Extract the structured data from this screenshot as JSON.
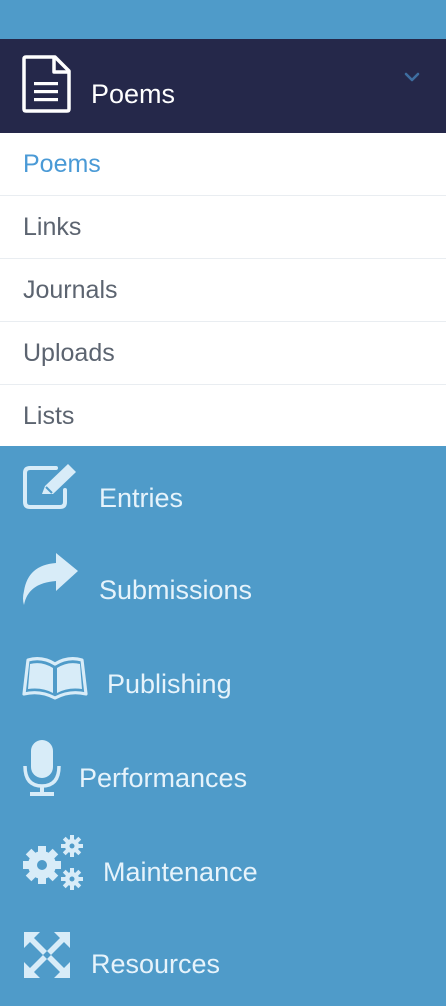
{
  "header": {
    "title": "Poems",
    "icon": "document-icon",
    "chevron": "chevron-down-icon"
  },
  "submenu": [
    {
      "label": "Poems",
      "active": true
    },
    {
      "label": "Links",
      "active": false
    },
    {
      "label": "Journals",
      "active": false
    },
    {
      "label": "Uploads",
      "active": false
    },
    {
      "label": "Lists",
      "active": false
    }
  ],
  "nav": [
    {
      "label": "Entries",
      "icon": "edit-icon"
    },
    {
      "label": "Submissions",
      "icon": "share-arrow-icon"
    },
    {
      "label": "Publishing",
      "icon": "open-book-icon"
    },
    {
      "label": "Performances",
      "icon": "microphone-icon"
    },
    {
      "label": "Maintenance",
      "icon": "gears-icon"
    },
    {
      "label": "Resources",
      "icon": "expand-arrows-icon"
    }
  ],
  "colors": {
    "sidebar_bg": "#4f9bc9",
    "header_bg": "#25284a",
    "active_text": "#4a9ad6",
    "submenu_text": "#5c6470",
    "nav_text": "#e6f3fb"
  }
}
